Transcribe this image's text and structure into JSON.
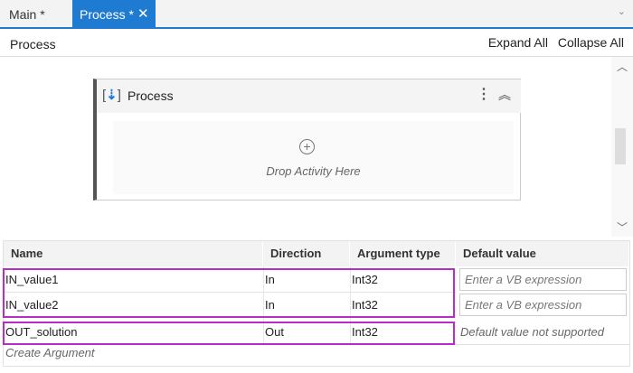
{
  "tabs": [
    {
      "label": "Main *"
    },
    {
      "label": "Process *",
      "close": "✕"
    }
  ],
  "tab_overflow": "⌄",
  "breadcrumb": "Process",
  "toolbar": {
    "expand_all": "Expand All",
    "collapse_all": "Collapse All"
  },
  "activity": {
    "title": "Process",
    "menu": "⋮",
    "collapse": "⌃",
    "drop_text": "Drop Activity Here",
    "plus": "+"
  },
  "arguments": {
    "columns": [
      "Name",
      "Direction",
      "Argument type",
      "Default value"
    ],
    "rows": [
      {
        "name": "IN_value1",
        "direction": "In",
        "type": "Int32",
        "default": "Enter a VB expression"
      },
      {
        "name": "IN_value2",
        "direction": "In",
        "type": "Int32",
        "default": "Enter a VB expression"
      },
      {
        "name": "OUT_solution",
        "direction": "Out",
        "type": "Int32",
        "default": "Default value not supported"
      }
    ],
    "create": "Create Argument"
  },
  "colors": {
    "accent": "#1f7ad1",
    "highlight": "#b82cc8"
  }
}
